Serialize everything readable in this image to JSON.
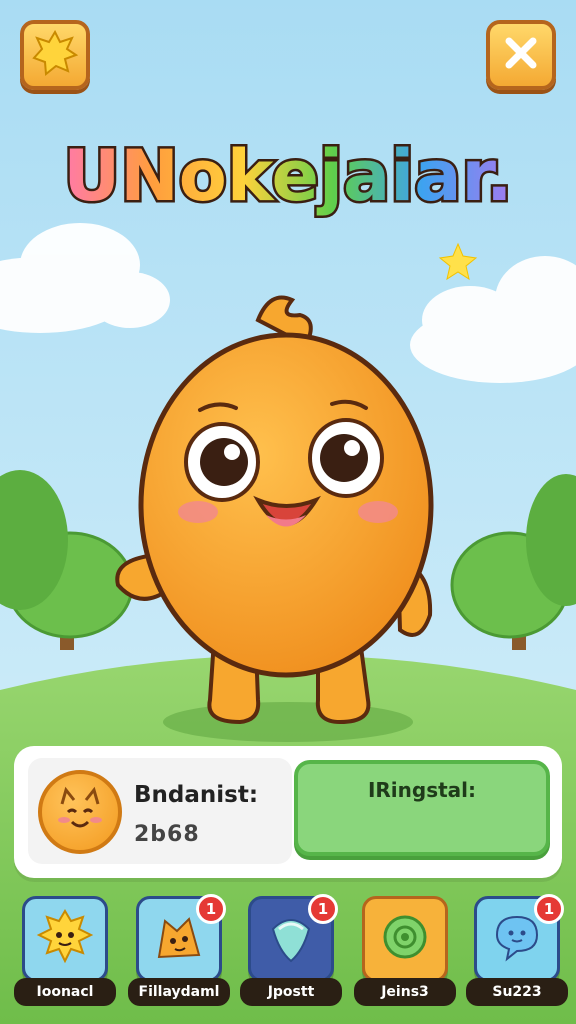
{
  "title": "UNokejaiar.",
  "colors": {
    "sky": "#bfe6f7",
    "grass": "#8fd06a",
    "accent_orange": "#f7a72f",
    "panel_green": "#8ad67c",
    "badge_red": "#e53935"
  },
  "header": {
    "left_icon": "sun-icon",
    "right_icon": "close-icon"
  },
  "info_panel": {
    "stat_label": "Bndanist:",
    "stat_value": "2b68",
    "action_label": "IRingstal:"
  },
  "nav": [
    {
      "label": "Ioonacl",
      "icon": "sun-creature-icon",
      "badge": "",
      "color": "#8fd7ee"
    },
    {
      "label": "Fillaydaml",
      "icon": "cat-creature-icon",
      "badge": "1",
      "color": "#8fd7ee"
    },
    {
      "label": "Jpostt",
      "icon": "gem-icon",
      "badge": "1",
      "color": "#3f5ca8"
    },
    {
      "label": "Jeins3",
      "icon": "ring-icon",
      "badge": "",
      "color": "#f7b23a"
    },
    {
      "label": "Su223",
      "icon": "speech-bubble-icon",
      "badge": "1",
      "color": "#7fd3ee"
    }
  ]
}
